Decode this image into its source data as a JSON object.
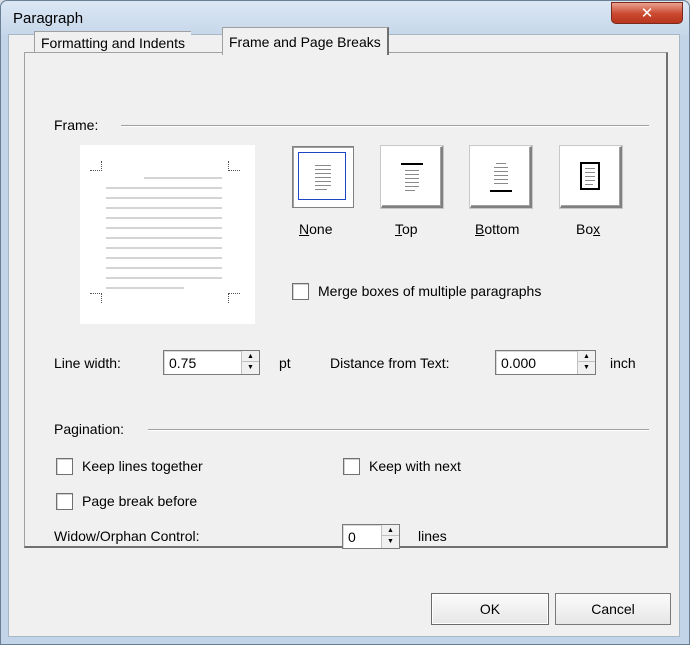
{
  "window": {
    "title": "Paragraph",
    "close_icon": "close-icon"
  },
  "tabs": [
    {
      "label": "Formatting and Indents",
      "active": false
    },
    {
      "label": "Frame and Page Breaks",
      "active": true
    }
  ],
  "frame": {
    "group_label": "Frame:",
    "options": [
      {
        "id": "none",
        "label": "None",
        "mnemonic": "N",
        "rest": "one",
        "selected": true
      },
      {
        "id": "top",
        "label": "Top",
        "mnemonic": "T",
        "rest": "op",
        "selected": false
      },
      {
        "id": "bottom",
        "label": "Bottom",
        "mnemonic": "B",
        "rest": "ottom",
        "selected": false
      },
      {
        "id": "box",
        "label": "Box",
        "pre": "Bo",
        "mnemonic": "x",
        "selected": false
      }
    ],
    "merge_label": "Merge boxes of multiple paragraphs",
    "merge_checked": false,
    "line_width_label": "Line width:",
    "line_width_value": "0.75",
    "line_width_unit": "pt",
    "distance_label": "Distance from Text:",
    "distance_value": "0.000",
    "distance_unit": "inch"
  },
  "pagination": {
    "group_label": "Pagination:",
    "keep_lines_label": "Keep lines together",
    "keep_lines_checked": false,
    "keep_next_label": "Keep with next",
    "keep_next_checked": false,
    "page_break_label": "Page break before",
    "page_break_checked": false,
    "widow_label": "Widow/Orphan Control:",
    "widow_value": "0",
    "widow_unit": "lines"
  },
  "buttons": {
    "ok": "OK",
    "cancel": "Cancel"
  }
}
